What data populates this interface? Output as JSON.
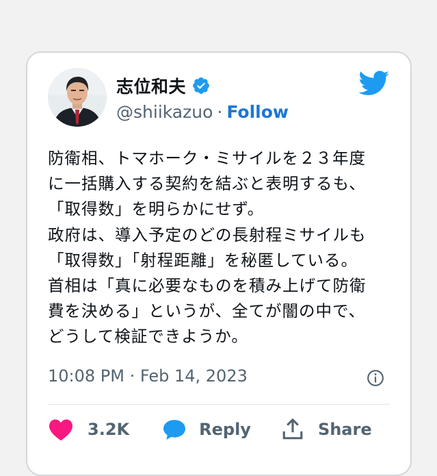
{
  "tweet": {
    "author_name": "志位和夫",
    "handle": "@shiikazuo",
    "separator": "·",
    "follow_label": "Follow",
    "body_lines": [
      "防衛相、トマホーク・ミサイルを２３年度",
      "に一括購入する契約を結ぶと表明するも、",
      "「取得数」を明らかにせず。",
      "政府は、導入予定のどの長射程ミサイルも",
      "「取得数」「射程距離」を秘匿している。",
      "首相は「真に必要なものを積み上げて防衛",
      "費を決める」というが、全てが闇の中で、",
      "どうして検証できようか。"
    ],
    "timestamp": "10:08 PM · Feb 14, 2023"
  },
  "actions": {
    "like_count": "3.2K",
    "reply_label": "Reply",
    "share_label": "Share"
  },
  "icons": {
    "verified": "verified-badge-icon",
    "brand": "twitter-bird-icon",
    "info": "info-icon",
    "like": "heart-icon",
    "reply": "reply-bubble-icon",
    "share": "share-icon"
  },
  "colors": {
    "brand_blue": "#1d9bf0",
    "follow_blue": "#1d77d4",
    "like_pink": "#f91880",
    "muted_text": "#536471",
    "card_border": "#d3d6da",
    "background": "#f2f2f2"
  }
}
